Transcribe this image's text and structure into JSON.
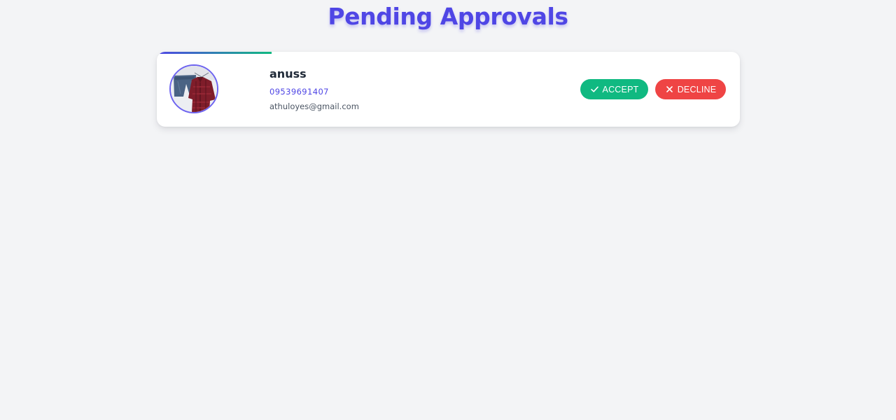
{
  "page": {
    "title": "Pending Approvals"
  },
  "requests": [
    {
      "name": "anuss",
      "phone": "09539691407",
      "email": "athuloyes@gmail.com",
      "accept_label": "ACCEPT",
      "decline_label": "DECLINE",
      "accept_icon": "check-icon",
      "decline_icon": "close-icon"
    }
  ],
  "colors": {
    "brand": "#4f46e5",
    "accept": "#10b981",
    "decline": "#ef4444",
    "background": "#f3f4f6"
  }
}
